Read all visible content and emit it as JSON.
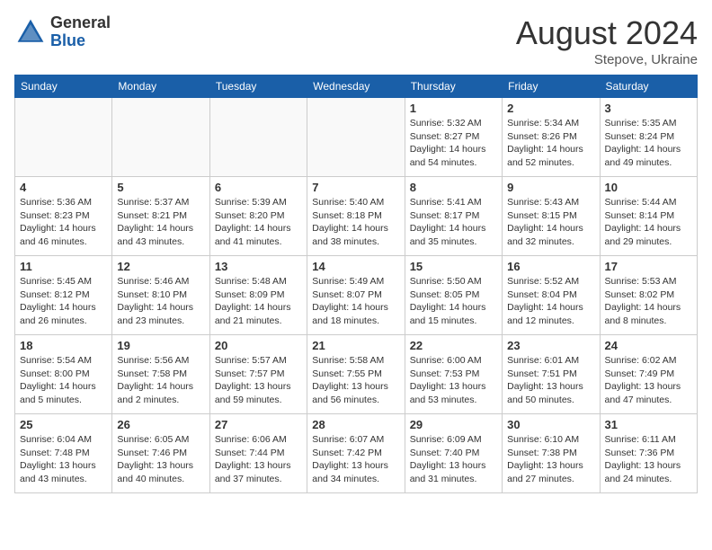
{
  "header": {
    "logo_general": "General",
    "logo_blue": "Blue",
    "month_year": "August 2024",
    "location": "Stepove, Ukraine"
  },
  "days_of_week": [
    "Sunday",
    "Monday",
    "Tuesday",
    "Wednesday",
    "Thursday",
    "Friday",
    "Saturday"
  ],
  "weeks": [
    [
      {
        "day": "",
        "info": ""
      },
      {
        "day": "",
        "info": ""
      },
      {
        "day": "",
        "info": ""
      },
      {
        "day": "",
        "info": ""
      },
      {
        "day": "1",
        "info": "Sunrise: 5:32 AM\nSunset: 8:27 PM\nDaylight: 14 hours\nand 54 minutes."
      },
      {
        "day": "2",
        "info": "Sunrise: 5:34 AM\nSunset: 8:26 PM\nDaylight: 14 hours\nand 52 minutes."
      },
      {
        "day": "3",
        "info": "Sunrise: 5:35 AM\nSunset: 8:24 PM\nDaylight: 14 hours\nand 49 minutes."
      }
    ],
    [
      {
        "day": "4",
        "info": "Sunrise: 5:36 AM\nSunset: 8:23 PM\nDaylight: 14 hours\nand 46 minutes."
      },
      {
        "day": "5",
        "info": "Sunrise: 5:37 AM\nSunset: 8:21 PM\nDaylight: 14 hours\nand 43 minutes."
      },
      {
        "day": "6",
        "info": "Sunrise: 5:39 AM\nSunset: 8:20 PM\nDaylight: 14 hours\nand 41 minutes."
      },
      {
        "day": "7",
        "info": "Sunrise: 5:40 AM\nSunset: 8:18 PM\nDaylight: 14 hours\nand 38 minutes."
      },
      {
        "day": "8",
        "info": "Sunrise: 5:41 AM\nSunset: 8:17 PM\nDaylight: 14 hours\nand 35 minutes."
      },
      {
        "day": "9",
        "info": "Sunrise: 5:43 AM\nSunset: 8:15 PM\nDaylight: 14 hours\nand 32 minutes."
      },
      {
        "day": "10",
        "info": "Sunrise: 5:44 AM\nSunset: 8:14 PM\nDaylight: 14 hours\nand 29 minutes."
      }
    ],
    [
      {
        "day": "11",
        "info": "Sunrise: 5:45 AM\nSunset: 8:12 PM\nDaylight: 14 hours\nand 26 minutes."
      },
      {
        "day": "12",
        "info": "Sunrise: 5:46 AM\nSunset: 8:10 PM\nDaylight: 14 hours\nand 23 minutes."
      },
      {
        "day": "13",
        "info": "Sunrise: 5:48 AM\nSunset: 8:09 PM\nDaylight: 14 hours\nand 21 minutes."
      },
      {
        "day": "14",
        "info": "Sunrise: 5:49 AM\nSunset: 8:07 PM\nDaylight: 14 hours\nand 18 minutes."
      },
      {
        "day": "15",
        "info": "Sunrise: 5:50 AM\nSunset: 8:05 PM\nDaylight: 14 hours\nand 15 minutes."
      },
      {
        "day": "16",
        "info": "Sunrise: 5:52 AM\nSunset: 8:04 PM\nDaylight: 14 hours\nand 12 minutes."
      },
      {
        "day": "17",
        "info": "Sunrise: 5:53 AM\nSunset: 8:02 PM\nDaylight: 14 hours\nand 8 minutes."
      }
    ],
    [
      {
        "day": "18",
        "info": "Sunrise: 5:54 AM\nSunset: 8:00 PM\nDaylight: 14 hours\nand 5 minutes."
      },
      {
        "day": "19",
        "info": "Sunrise: 5:56 AM\nSunset: 7:58 PM\nDaylight: 14 hours\nand 2 minutes."
      },
      {
        "day": "20",
        "info": "Sunrise: 5:57 AM\nSunset: 7:57 PM\nDaylight: 13 hours\nand 59 minutes."
      },
      {
        "day": "21",
        "info": "Sunrise: 5:58 AM\nSunset: 7:55 PM\nDaylight: 13 hours\nand 56 minutes."
      },
      {
        "day": "22",
        "info": "Sunrise: 6:00 AM\nSunset: 7:53 PM\nDaylight: 13 hours\nand 53 minutes."
      },
      {
        "day": "23",
        "info": "Sunrise: 6:01 AM\nSunset: 7:51 PM\nDaylight: 13 hours\nand 50 minutes."
      },
      {
        "day": "24",
        "info": "Sunrise: 6:02 AM\nSunset: 7:49 PM\nDaylight: 13 hours\nand 47 minutes."
      }
    ],
    [
      {
        "day": "25",
        "info": "Sunrise: 6:04 AM\nSunset: 7:48 PM\nDaylight: 13 hours\nand 43 minutes."
      },
      {
        "day": "26",
        "info": "Sunrise: 6:05 AM\nSunset: 7:46 PM\nDaylight: 13 hours\nand 40 minutes."
      },
      {
        "day": "27",
        "info": "Sunrise: 6:06 AM\nSunset: 7:44 PM\nDaylight: 13 hours\nand 37 minutes."
      },
      {
        "day": "28",
        "info": "Sunrise: 6:07 AM\nSunset: 7:42 PM\nDaylight: 13 hours\nand 34 minutes."
      },
      {
        "day": "29",
        "info": "Sunrise: 6:09 AM\nSunset: 7:40 PM\nDaylight: 13 hours\nand 31 minutes."
      },
      {
        "day": "30",
        "info": "Sunrise: 6:10 AM\nSunset: 7:38 PM\nDaylight: 13 hours\nand 27 minutes."
      },
      {
        "day": "31",
        "info": "Sunrise: 6:11 AM\nSunset: 7:36 PM\nDaylight: 13 hours\nand 24 minutes."
      }
    ]
  ]
}
